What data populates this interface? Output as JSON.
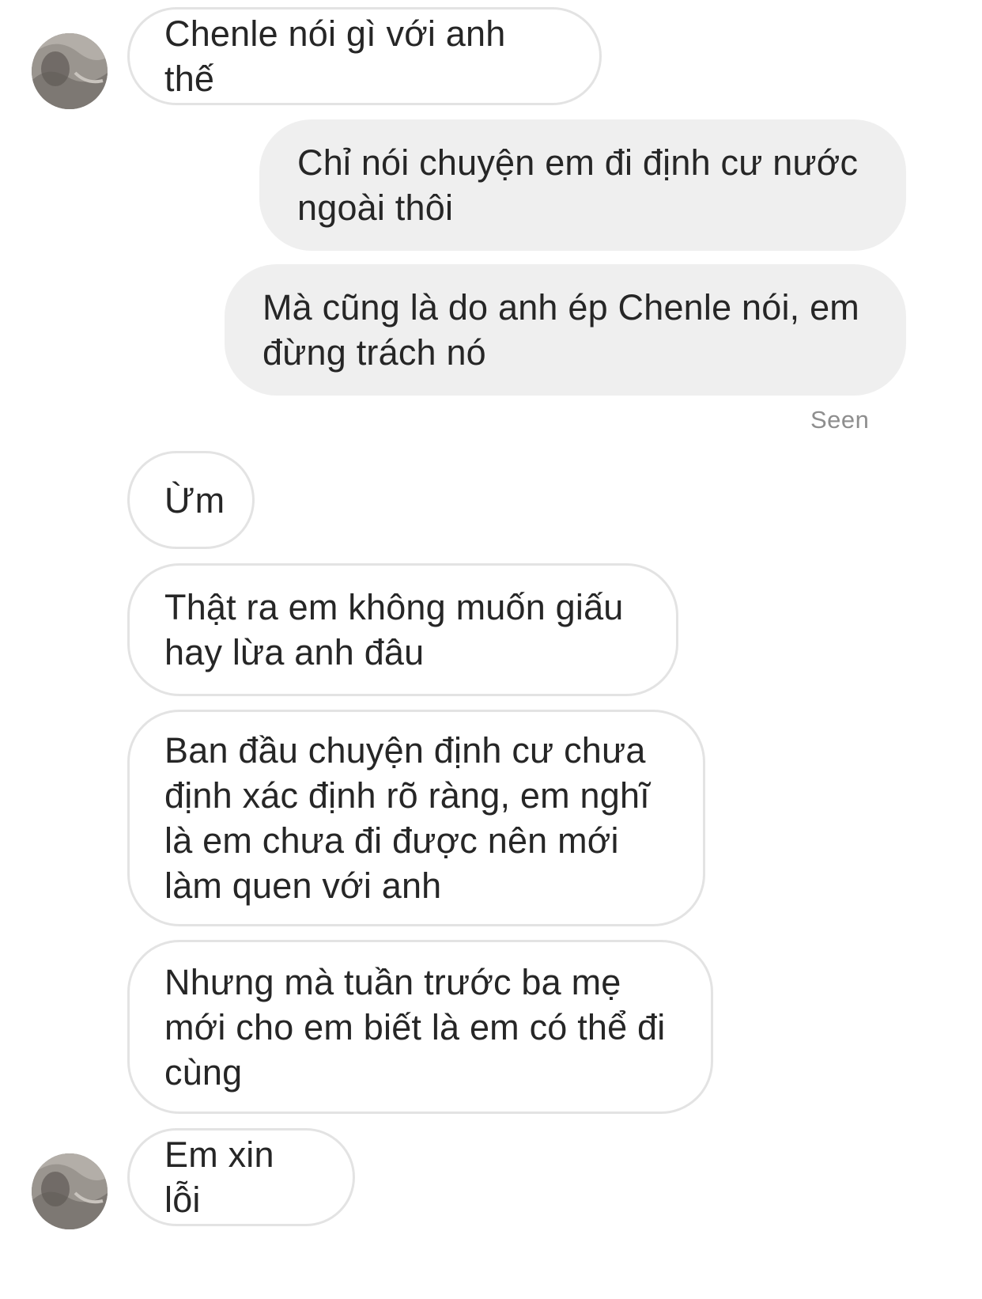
{
  "conversation": {
    "messages": [
      {
        "sender": "them",
        "text": "Chenle nói gì với anh thế"
      },
      {
        "sender": "me",
        "text": "Chỉ nói chuyện em đi định cư nước ngoài thôi"
      },
      {
        "sender": "me",
        "text": "Mà cũng là do anh ép Chenle nói, em đừng trách nó"
      },
      {
        "sender": "them",
        "text": "Ừm"
      },
      {
        "sender": "them",
        "text": "Thật ra em không muốn giấu hay lừa anh đâu"
      },
      {
        "sender": "them",
        "text": "Ban đầu chuyện định cư chưa định xác định rõ ràng, em nghĩ là em chưa đi được nên mới làm quen với anh"
      },
      {
        "sender": "them",
        "text": "Nhưng mà tuần trước ba mẹ mới cho em biết là em có thể đi cùng"
      },
      {
        "sender": "them",
        "text": "Em xin lỗi"
      }
    ],
    "seen_label": "Seen"
  },
  "colors": {
    "incoming_border": "#e3e3e3",
    "outgoing_bg": "#efefef",
    "text": "#262626",
    "seen_text": "#8e8e8e"
  },
  "icons": {
    "avatar": "profile-photo"
  }
}
